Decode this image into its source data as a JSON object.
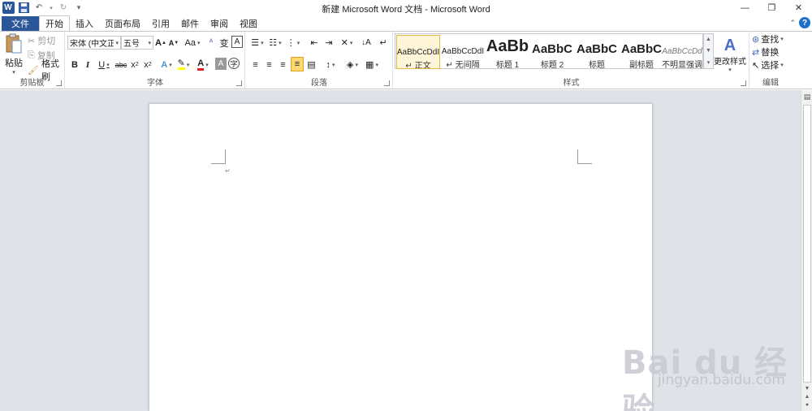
{
  "title": "新建 Microsoft Word 文档 - Microsoft Word",
  "tabs": {
    "file": "文件",
    "home": "开始",
    "insert": "插入",
    "layout": "页面布局",
    "references": "引用",
    "mailings": "邮件",
    "review": "审阅",
    "view": "视图"
  },
  "clipboard": {
    "paste": "粘贴",
    "cut": "剪切",
    "copy": "复制",
    "format_painter": "格式刷",
    "group_label": "剪贴板"
  },
  "font": {
    "family": "宋体 (中文正文",
    "size": "五号",
    "group_label": "字体"
  },
  "paragraph": {
    "group_label": "段落"
  },
  "styles": {
    "group_label": "样式",
    "change_styles": "更改样式",
    "items": [
      {
        "sample": "AaBbCcDdI",
        "name": "↵ 正文"
      },
      {
        "sample": "AaBbCcDdI",
        "name": "↵ 无间隔"
      },
      {
        "sample": "AaBb",
        "name": "标题 1"
      },
      {
        "sample": "AaBbC",
        "name": "标题 2"
      },
      {
        "sample": "AaBbC",
        "name": "标题"
      },
      {
        "sample": "AaBbC",
        "name": "副标题"
      },
      {
        "sample": "AaBbCcDd",
        "name": "不明显强调"
      }
    ]
  },
  "editing": {
    "find": "查找",
    "replace": "替换",
    "select": "选择",
    "group_label": "编辑"
  },
  "watermark": {
    "main": "Bai du 经验",
    "sub": "jingyan.baidu.com"
  },
  "colors": {
    "accent": "#2b579a",
    "highlight": "#ffff00",
    "font_color": "#e02020"
  }
}
